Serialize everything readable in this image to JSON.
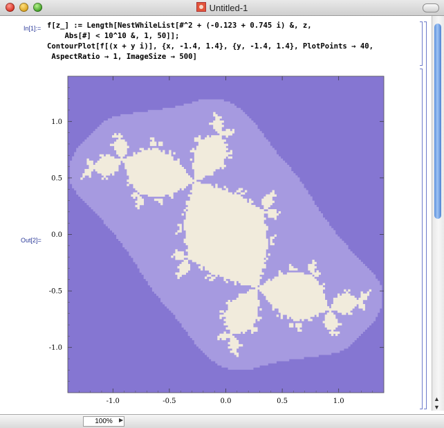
{
  "window": {
    "title": "Untitled-1"
  },
  "input_cell": {
    "label": "In[1]:=",
    "line1": "f[z_] := Length[NestWhileList[#^2 + (-0.123 + 0.745 i) &, z,",
    "line2": "    Abs[#] < 10^10 &, 1, 50]];",
    "line3": "ContourPlot[f[(x + y i)], {x, -1.4, 1.4}, {y, -1.4, 1.4}, PlotPoints → 40,",
    "line4": " AspectRatio → 1, ImageSize → 500]"
  },
  "output_cell": {
    "label": "Out[2]="
  },
  "chart_data": {
    "type": "contour",
    "x_ticks": [
      "-1.0",
      "-0.5",
      "0.0",
      "0.5",
      "1.0"
    ],
    "y_ticks": [
      "1.0",
      "0.5",
      "0.0",
      "-0.5",
      "-1.0"
    ],
    "xlim": [
      -1.4,
      1.4
    ],
    "ylim": [
      -1.4,
      1.4
    ],
    "c": [
      -0.123,
      0.745
    ],
    "max_iterations": 50,
    "colors": {
      "outer": "#4b1d8c",
      "band1": "#5c3aa6",
      "band2": "#6f56bd",
      "band3": "#8576d2",
      "band4": "#a69ae0",
      "interior": "#f1ebdc"
    }
  },
  "status": {
    "zoom": "100%"
  }
}
